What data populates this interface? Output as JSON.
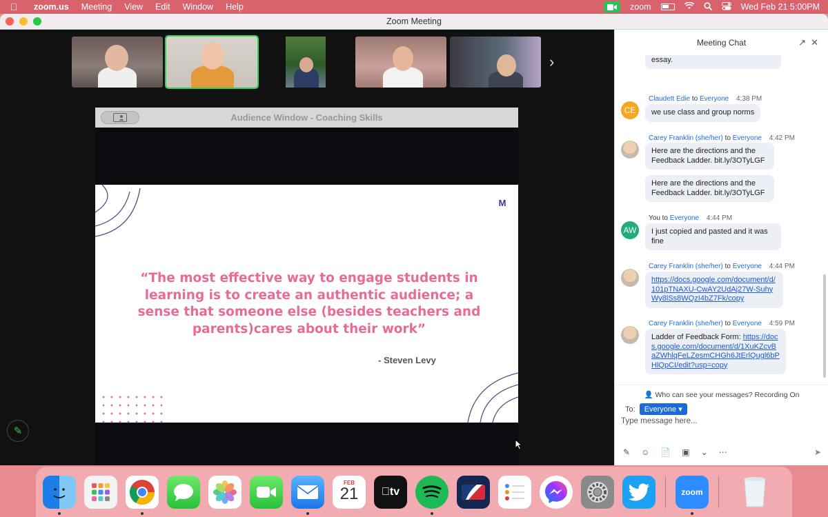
{
  "menubar": {
    "app_name": "zoom.us",
    "items": [
      "Meeting",
      "View",
      "Edit",
      "Window",
      "Help"
    ],
    "status_app": "zoom",
    "datetime": "Wed Feb 21  5:00PM"
  },
  "window": {
    "title": "Zoom Meeting"
  },
  "share": {
    "title": "Audience Window - Coaching Skills",
    "logo": "M",
    "quote": "“The most effective way to engage students in learning is to create an authentic audience; a sense that someone else (besides teachers and parents)cares about their work”",
    "author": "- Steven Levy"
  },
  "chat": {
    "title": "Meeting Chat",
    "messages": [
      {
        "text": "essay."
      },
      {
        "initials": "CE",
        "sender": "Claudett Edie",
        "to_word": "to",
        "recipient": "Everyone",
        "time": "4:38 PM",
        "text": "we use class and group norms"
      },
      {
        "sender": "Carey Franklin (she/her)",
        "to_word": "to",
        "recipient": "Everyone",
        "time": "4:42 PM",
        "text": "Here are the directions and the Feedback Ladder. bit.ly/3OTyLGF"
      },
      {
        "text": "Here are the directions and the Feedback Ladder. bit.ly/3OTyLGF"
      },
      {
        "initials": "AW",
        "sender": "You",
        "to_word": "to",
        "recipient": "Everyone",
        "time": "4:44 PM",
        "text": "I just copied and pasted and it was fine"
      },
      {
        "sender": "Carey Franklin (she/her)",
        "to_word": "to",
        "recipient": "Everyone",
        "time": "4:44 PM",
        "link": "https://docs.google.com/document/d/101pTNAXU-CwAY2UdAj27W-SuhyWy8lSs8WQzI4bZ7Fk/copy"
      },
      {
        "sender": "Carey Franklin (she/her)",
        "to_word": "to",
        "recipient": "Everyone",
        "time": "4:59 PM",
        "text": "Ladder of Feedback Form: ",
        "link": "https://docs.google.com/document/d/1XuKZcvBaZWhlqFeLZesmCHGh6JtErlQugl6bPHlQpCI/edit?usp=copy"
      }
    ],
    "visibility_note": "Who can see your messages? Recording On",
    "to_label": "To:",
    "to_value": "Everyone",
    "input_placeholder": "Type message here..."
  },
  "dock": {
    "calendar_month": "FEB",
    "calendar_day": "21",
    "tv_label": "tv",
    "zoom_label": "zoom",
    "apps": [
      "finder-icon",
      "launchpad-icon",
      "chrome-icon",
      "messages-icon",
      "photos-icon",
      "facetime-icon",
      "mail-icon",
      "calendar-icon",
      "appletv-icon",
      "spotify-icon",
      "mlb-icon",
      "reminders-icon",
      "messenger-icon",
      "system-preferences-icon",
      "twitter-icon",
      "zoom-icon",
      "trash-icon"
    ]
  },
  "colors": {
    "menubar": "#d9636c",
    "accent_blue": "#1a6bd6",
    "quote_pink": "#e86b95",
    "active_green": "#33d15a"
  }
}
